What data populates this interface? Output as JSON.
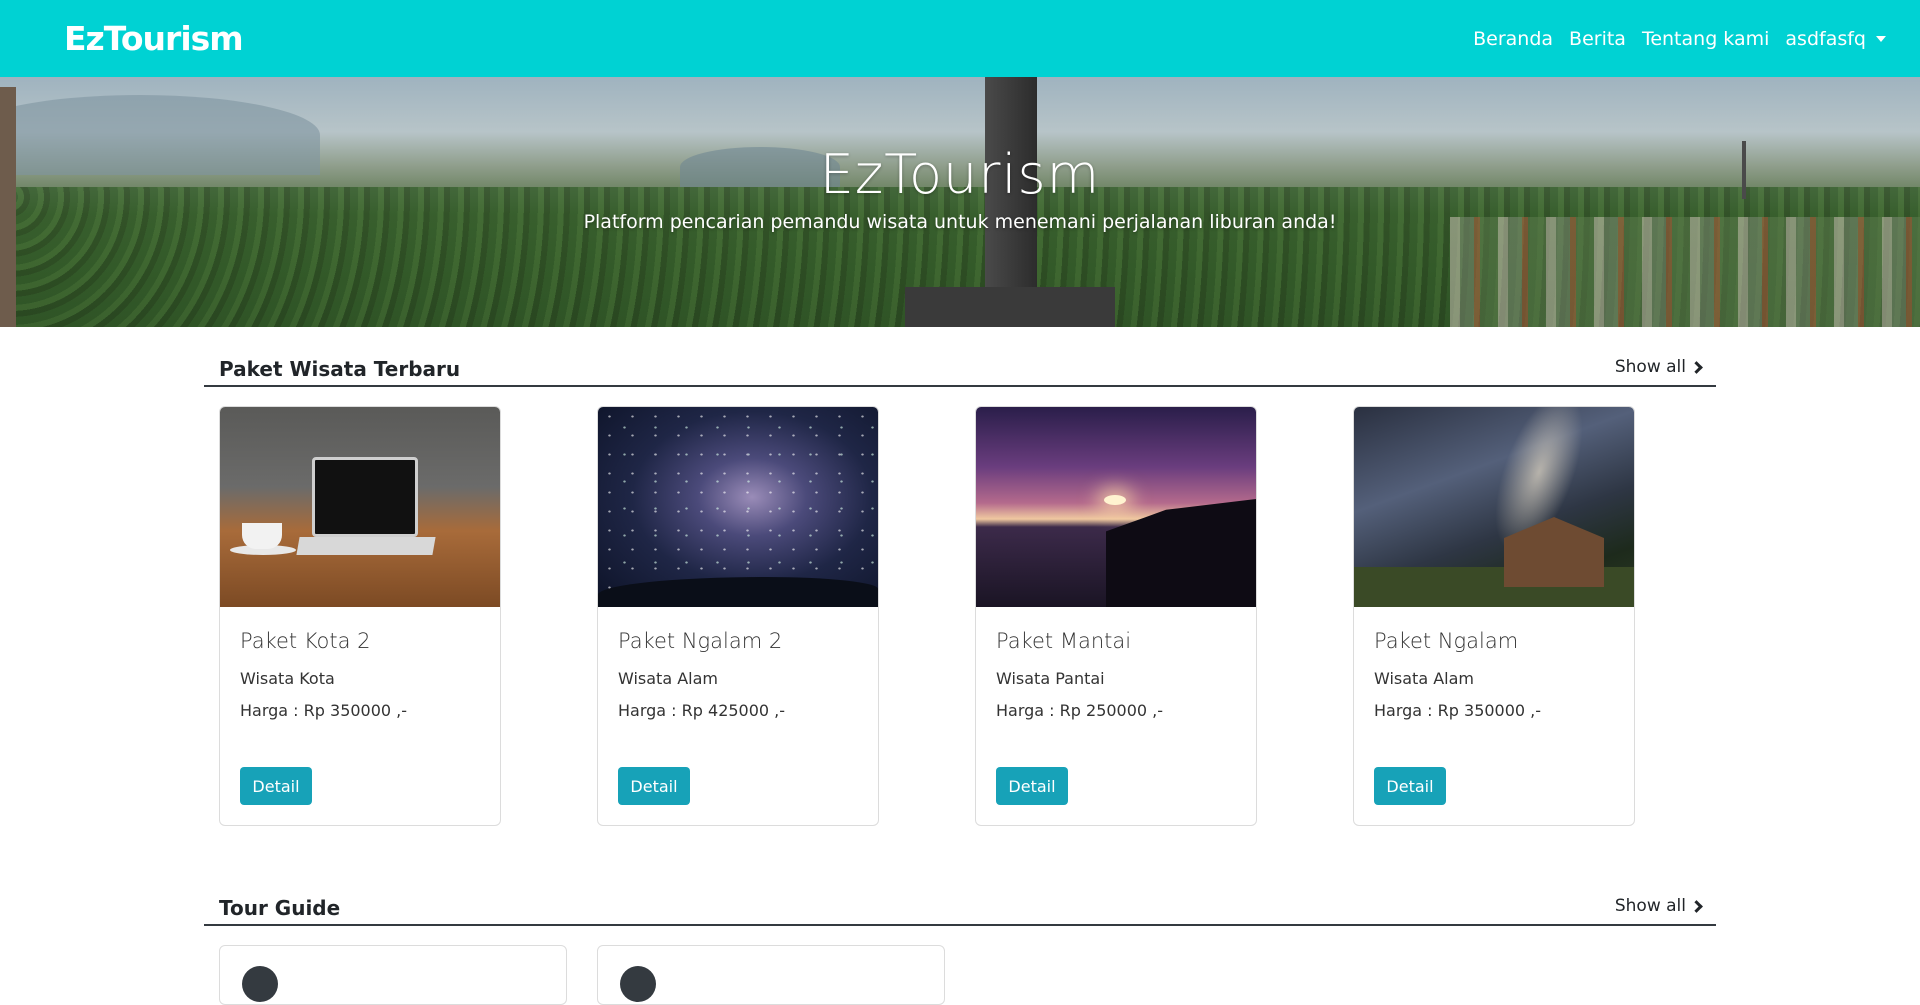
{
  "navbar": {
    "brand": "EzTourism",
    "links": [
      "Beranda",
      "Berita",
      "Tentang kami"
    ],
    "user": "asdfasfq"
  },
  "hero": {
    "title": "EzTourism",
    "subtitle": "Platform pencarian pemandu wisata untuk menemani perjalanan liburan anda!"
  },
  "paket_section": {
    "title": "Paket Wisata Terbaru",
    "show_all": "Show all"
  },
  "packages": [
    {
      "title": "Paket Kota 2",
      "category": "Wisata Kota",
      "price": "Harga : Rp 350000 ,-",
      "button": "Detail"
    },
    {
      "title": "Paket Ngalam 2",
      "category": "Wisata Alam",
      "price": "Harga : Rp 425000 ,-",
      "button": "Detail"
    },
    {
      "title": "Paket Mantai",
      "category": "Wisata Pantai",
      "price": "Harga : Rp 250000 ,-",
      "button": "Detail"
    },
    {
      "title": "Paket Ngalam",
      "category": "Wisata Alam",
      "price": "Harga : Rp 350000 ,-",
      "button": "Detail"
    }
  ],
  "guide_section": {
    "title": "Tour Guide",
    "show_all": "Show all"
  },
  "colors": {
    "navbar": "#00d2d3",
    "button": "#17a2b8"
  }
}
